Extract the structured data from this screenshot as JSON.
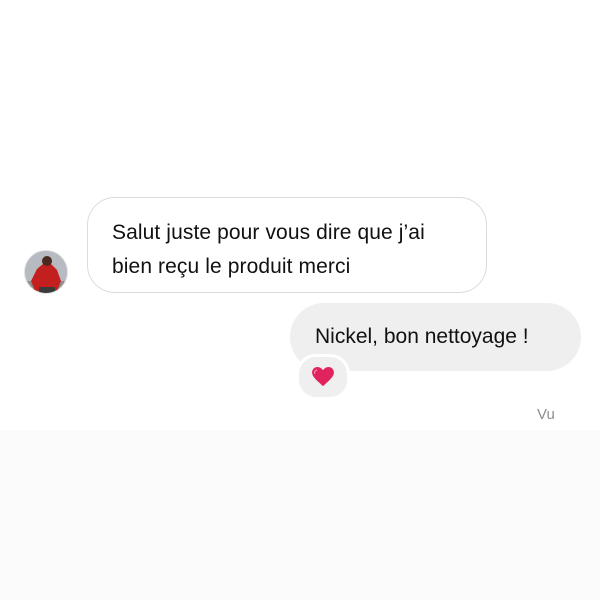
{
  "conversation": {
    "incoming": {
      "text": "Salut juste pour vous dire que j’ai\nbien reçu le produit merci",
      "line1": "Salut juste pour vous dire que j’ai",
      "line2": "bien reçu le produit merci"
    },
    "outgoing": {
      "text": "Nickel, bon nettoyage !",
      "reaction": "heart-icon",
      "reaction_color": "#e0245e"
    },
    "status": "Vu"
  },
  "colors": {
    "incoming_bubble_border": "#dbdbdb",
    "outgoing_bubble_bg": "#efefef",
    "status_text": "#8e8e8e"
  }
}
